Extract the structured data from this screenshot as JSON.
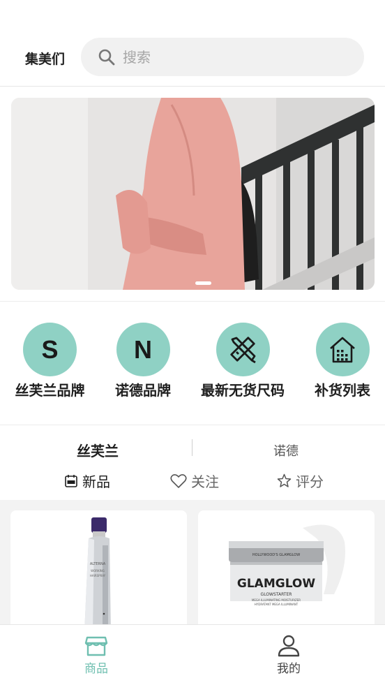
{
  "header": {
    "brand": "集美们",
    "search_placeholder": "搜索",
    "search_icon": "search-icon"
  },
  "banner": {
    "image": "pink-hoodie-photo",
    "active_dot": 1
  },
  "entries": [
    {
      "letter": "S",
      "label": "丝芙兰品牌",
      "icon": "letter-s"
    },
    {
      "letter": "N",
      "label": "诺德品牌",
      "icon": "letter-n"
    },
    {
      "letter": "",
      "label": "最新无货尺码",
      "icon": "ruler-pencil-icon"
    },
    {
      "letter": "",
      "label": "补货列表",
      "icon": "house-grid-icon"
    }
  ],
  "tabs": [
    {
      "label": "丝芙兰",
      "active": true
    },
    {
      "label": "诺德",
      "active": false
    }
  ],
  "sort": {
    "new_label": "新品",
    "follow_label": "关注",
    "rating_label": "评分"
  },
  "products": [
    {
      "image": "hairspray-bottle"
    },
    {
      "image": "glamglow-jar",
      "brand_text": "GLAMGLOW",
      "sub_text": "GLOWSTARTER"
    }
  ],
  "nav": {
    "home_label": "商品",
    "me_label": "我的"
  },
  "colors": {
    "accent": "#8fd1c4",
    "nav_active": "#6fbfb0"
  }
}
